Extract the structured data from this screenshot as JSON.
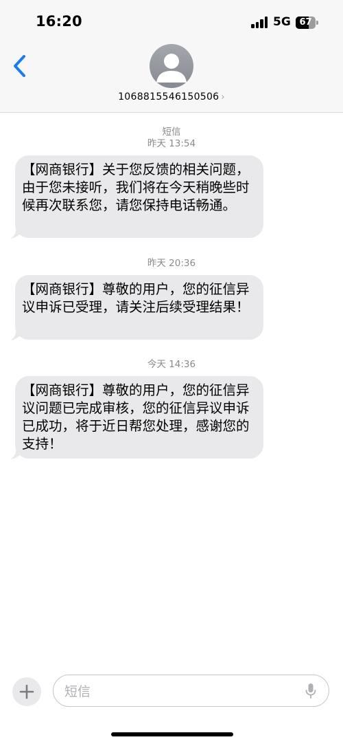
{
  "status_bar": {
    "time": "16:20",
    "network": "5G",
    "battery_level": "67",
    "battery_fraction": 0.67
  },
  "header": {
    "contact": "1068815546150506",
    "chevron": "›"
  },
  "conversation": {
    "service_label": "短信",
    "messages": [
      {
        "timestamp": "昨天 13:54",
        "text": "【网商银行】关于您反馈的相关问题，由于您未接听，我们将在今天稍晚些时候再次联系您，请您保持电话畅通。"
      },
      {
        "timestamp": "昨天 20:36",
        "text": "【网商银行】尊敬的用户，您的征信异议申诉已受理，请关注后续受理结果！"
      },
      {
        "timestamp": "今天 14:36",
        "text": "【网商银行】尊敬的用户，您的征信异议问题已完成审核，您的征信异议申诉已成功，将于近日帮您处理，感谢您的支持！"
      }
    ]
  },
  "composer": {
    "placeholder": "短信"
  },
  "colors": {
    "accent": "#1a7bf5",
    "bubble_incoming": "#e9e9eb",
    "meta_text": "#8a8a8e"
  },
  "icons": {
    "back": "chevron-left-icon",
    "avatar": "person-icon",
    "plus": "plus-icon",
    "mic": "microphone-icon"
  }
}
